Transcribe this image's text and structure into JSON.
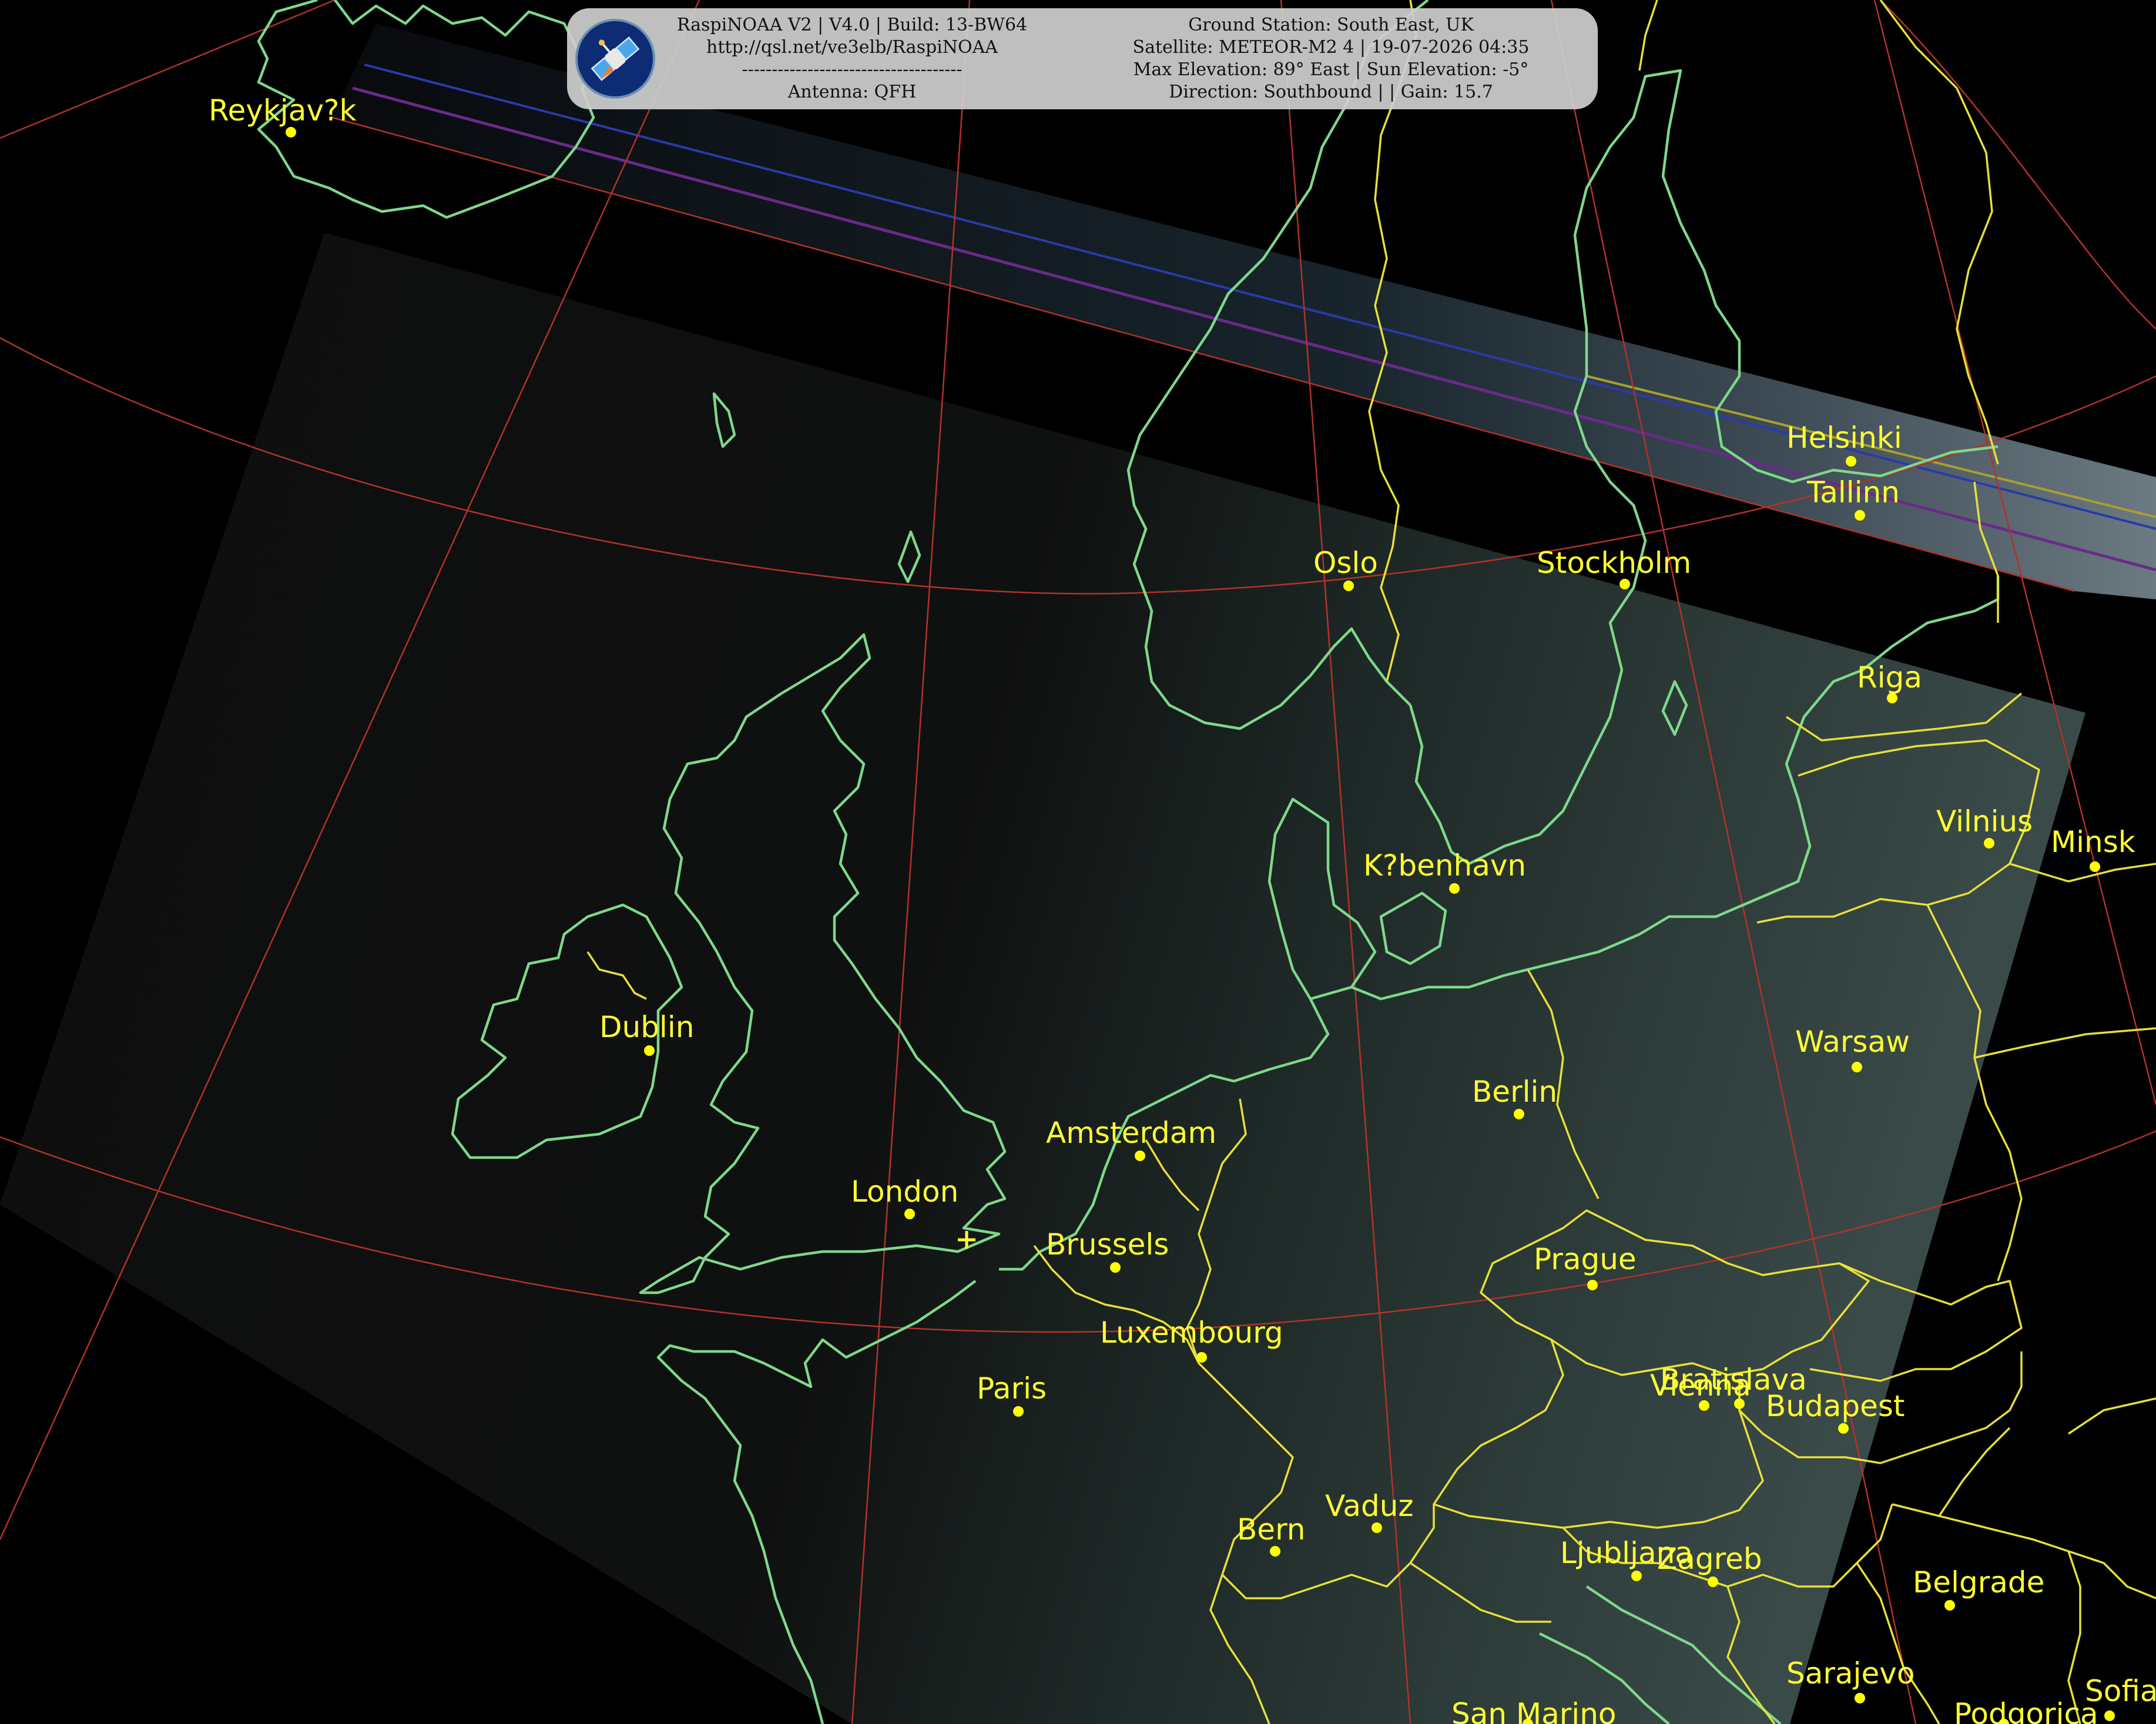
{
  "header": {
    "left_lines": [
      "RaspiNOAA V2 | V4.0 | Build: 13-BW64",
      "http://qsl.net/ve3elb/RaspiNOAA",
      "-------------------------------------",
      "Antenna: QFH"
    ],
    "right_lines": [
      "Ground Station: South East, UK",
      "Satellite: METEOR-M2 4 | 19-07-2026 04:35",
      "Max Elevation: 89° East | Sun Elevation: -5°",
      "Direction: Southbound | | Gain: 15.7"
    ]
  },
  "cities": [
    {
      "name": "Reykjav?k"
    },
    {
      "name": "Helsinki"
    },
    {
      "name": "Tallinn"
    },
    {
      "name": "Oslo"
    },
    {
      "name": "Stockholm"
    },
    {
      "name": "Riga"
    },
    {
      "name": "Vilnius"
    },
    {
      "name": "Minsk"
    },
    {
      "name": "K?benhavn"
    },
    {
      "name": "Dublin"
    },
    {
      "name": "Amsterdam"
    },
    {
      "name": "Berlin"
    },
    {
      "name": "Warsaw"
    },
    {
      "name": "London"
    },
    {
      "name": "Brussels"
    },
    {
      "name": "Prague"
    },
    {
      "name": "Luxembourg"
    },
    {
      "name": "Paris"
    },
    {
      "name": "Bratislava"
    },
    {
      "name": "Vienna"
    },
    {
      "name": "Budapest"
    },
    {
      "name": "Vaduz"
    },
    {
      "name": "Bern"
    },
    {
      "name": "Ljubljana"
    },
    {
      "name": "Zagreb"
    },
    {
      "name": "Belgrade"
    },
    {
      "name": "Sarajevo"
    },
    {
      "name": "Sofia"
    },
    {
      "name": "San Marino"
    },
    {
      "name": "Podgorica"
    }
  ],
  "colors": {
    "background": "#000000",
    "coastline": "#7ed88a",
    "borders": "#e6e03a",
    "graticule": "#b2322b",
    "city": "#ffff33"
  },
  "icons": {
    "logo": "satellite-logo-icon",
    "ground_station": "ground-station-marker-icon"
  }
}
